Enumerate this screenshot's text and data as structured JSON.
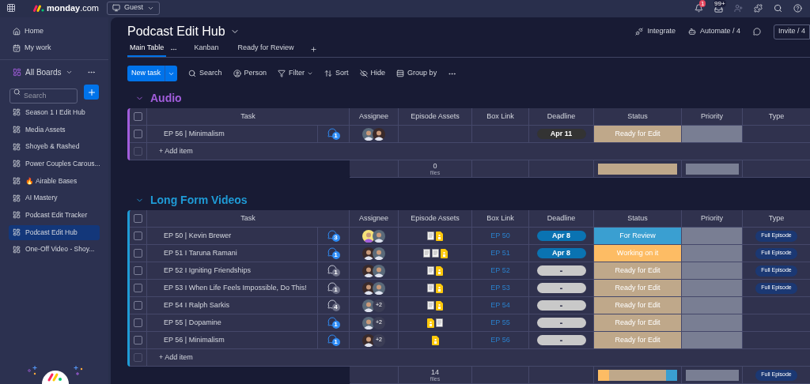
{
  "topbar": {
    "brand": "monday",
    "brand_suffix": ".com",
    "workspace": "Guest",
    "notifications_badge": "1",
    "inbox_badge": "99+"
  },
  "sidebar": {
    "nav": [
      {
        "kind": "home",
        "label": "Home"
      },
      {
        "kind": "work",
        "label": "My work"
      }
    ],
    "workspace_label": "All Boards",
    "search": {
      "placeholder": "Search"
    },
    "boards": [
      {
        "label": "Season 1 I Edit Hub",
        "selected": false
      },
      {
        "label": "Media Assets",
        "selected": false
      },
      {
        "label": "Shoyeb & Rashed",
        "selected": false
      },
      {
        "label": "Power Couples Carous...",
        "selected": false
      },
      {
        "label": "🔥 Airable Bases",
        "selected": false
      },
      {
        "label": "AI Mastery",
        "selected": false
      },
      {
        "label": "Podcast Edit Tracker",
        "selected": false
      },
      {
        "label": "Podcast Edit Hub",
        "selected": true
      },
      {
        "label": "One-Off Video - Shoy...",
        "selected": false
      }
    ]
  },
  "board": {
    "title": "Podcast Edit Hub",
    "actions": [
      "Integrate",
      "Automate / 4"
    ],
    "invite": "Invite / 4",
    "tabs": [
      {
        "label": "Main Table",
        "selected": true
      },
      {
        "label": "Kanban",
        "selected": false
      },
      {
        "label": "Ready for Review",
        "selected": false
      }
    ],
    "toolbar": {
      "new_task": "New task",
      "tools": [
        "Search",
        "Person",
        "Filter",
        "Sort",
        "Hide",
        "Group by"
      ]
    },
    "groups": [
      {
        "name": "Audio",
        "color": "#a25ddc",
        "all_checked": false,
        "columns": [
          "Task",
          "Assignee",
          "Episode Assets",
          "Box Link",
          "Deadline",
          "Status",
          "Priority",
          "Type"
        ],
        "rows": [
          {
            "task": "EP 56 | Minimalism",
            "checked": false,
            "comments": {
              "count": "1",
              "active": true
            },
            "assignees": [
              {
                "kind": "light"
              },
              {
                "kind": "dark"
              }
            ],
            "deadline": {
              "text": "Apr 11",
              "color": "#333333"
            },
            "status": {
              "label": "Ready for Edit",
              "color": "#bfa88a"
            }
          }
        ],
        "add_item": "+ Add item",
        "summary": {
          "files": "0",
          "files_label": "files"
        }
      },
      {
        "name": "Long Form Videos",
        "color": "#1f9bd6",
        "all_checked": false,
        "columns": [
          "Task",
          "Assignee",
          "Episode Assets",
          "Box Link",
          "Deadline",
          "Status",
          "Priority",
          "Type"
        ],
        "rows": [
          {
            "task": "EP 50 | Kevin Brewer",
            "checked": false,
            "comments": {
              "count": "3",
              "active": true
            },
            "assignees": [
              {
                "kind": "yellow"
              },
              {
                "kind": "light"
              }
            ],
            "assets": [
              {
                "kind": "doc"
              },
              {
                "kind": "file"
              }
            ],
            "box_link": "EP 50",
            "deadline": {
              "text": "Apr 8",
              "color": "#0a73b2"
            },
            "status": {
              "label": "For Review",
              "color": "#3a9fd1"
            },
            "type": "Full Episode"
          },
          {
            "task": "EP 51 I Taruna Ramani",
            "checked": false,
            "comments": {
              "count": "1",
              "active": true
            },
            "assignees": [
              {
                "kind": "dark"
              },
              {
                "kind": "light"
              }
            ],
            "assets": [
              {
                "kind": "doc"
              },
              {
                "kind": "doc"
              },
              {
                "kind": "file"
              }
            ],
            "box_link": "EP 51",
            "deadline": {
              "text": "Apr 8",
              "color": "#0a73b2"
            },
            "status": {
              "label": "Working on it",
              "color": "#fdbc64"
            },
            "type": "Full Episode"
          },
          {
            "task": "EP 52 I Igniting Friendships",
            "checked": false,
            "comments": {
              "count": "1",
              "active": false
            },
            "assignees": [
              {
                "kind": "dark"
              },
              {
                "kind": "light"
              }
            ],
            "assets": [
              {
                "kind": "doc"
              },
              {
                "kind": "file"
              }
            ],
            "box_link": "EP 52",
            "deadline": {
              "text": "-",
              "color": "#c9c9c9"
            },
            "status": {
              "label": "Ready for Edit",
              "color": "#bfa88a"
            },
            "type": "Full Episode"
          },
          {
            "task": "EP 53 I When Life Feels Impossible, Do This!",
            "checked": false,
            "comments": {
              "count": "1",
              "active": false
            },
            "assignees": [
              {
                "kind": "dark"
              },
              {
                "kind": "light"
              }
            ],
            "assets": [
              {
                "kind": "doc"
              },
              {
                "kind": "file"
              }
            ],
            "box_link": "EP 53",
            "deadline": {
              "text": "-",
              "color": "#c9c9c9"
            },
            "status": {
              "label": "Ready for Edit",
              "color": "#bfa88a"
            },
            "type": "Full Episode"
          },
          {
            "task": "EP 54 I Ralph Sarkis",
            "checked": false,
            "comments": {
              "count": "4",
              "active": false
            },
            "assignees": [
              {
                "kind": "light"
              }
            ],
            "assignee_extra": "+2",
            "assets": [
              {
                "kind": "doc"
              },
              {
                "kind": "file"
              }
            ],
            "box_link": "EP 54",
            "deadline": {
              "text": "-",
              "color": "#c9c9c9"
            },
            "status": {
              "label": "Ready for Edit",
              "color": "#bfa88a"
            }
          },
          {
            "task": "EP 55 | Dopamine",
            "checked": false,
            "comments": {
              "count": "1",
              "active": true
            },
            "assignees": [
              {
                "kind": "light"
              }
            ],
            "assignee_extra": "+2",
            "assets": [
              {
                "kind": "file"
              },
              {
                "kind": "doc"
              }
            ],
            "box_link": "EP 55",
            "deadline": {
              "text": "-",
              "color": "#c9c9c9"
            },
            "status": {
              "label": "Ready for Edit",
              "color": "#bfa88a"
            }
          },
          {
            "task": "EP 56 | Minimalism",
            "checked": false,
            "comments": {
              "count": "1",
              "active": true
            },
            "assignees": [
              {
                "kind": "dark"
              }
            ],
            "assignee_extra": "+2",
            "assets": [
              {
                "kind": "file"
              }
            ],
            "box_link": "EP 56",
            "deadline": {
              "text": "-",
              "color": "#c9c9c9"
            },
            "status": {
              "label": "Ready for Edit",
              "color": "#bfa88a"
            }
          }
        ],
        "add_item": "+ Add item",
        "summary": {
          "files": "14",
          "files_label": "files",
          "type": "Full Episode"
        }
      }
    ]
  }
}
